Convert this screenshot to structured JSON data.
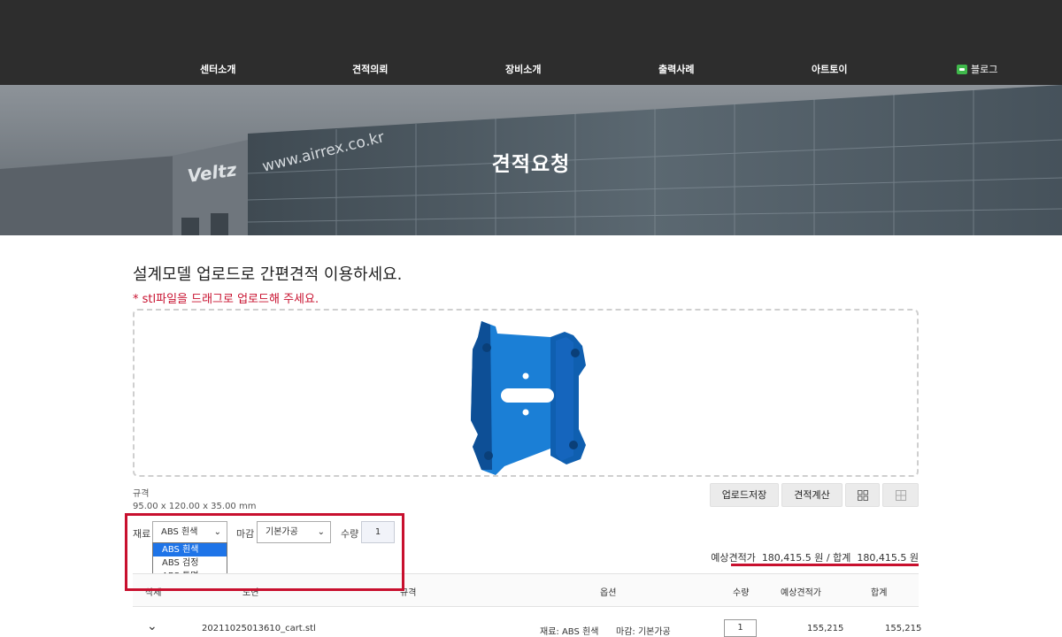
{
  "nav": {
    "items": [
      "센터소개",
      "견적의뢰",
      "장비소개",
      "출력사례",
      "아트토이"
    ],
    "blog": "블로그"
  },
  "hero": {
    "title": "견적요청"
  },
  "upload": {
    "headline": "설계모델 업로드로 간편견적 이용하세요.",
    "note": "* stl파일을 드래그로 업로드해 주세요."
  },
  "spec": {
    "label": "규격",
    "value": "95.00 x 120.00 x 35.00 mm"
  },
  "buttons": {
    "save": "업로드저장",
    "calc": "견적계산"
  },
  "options": {
    "material_label": "재료",
    "material_selected": "ABS 흰색",
    "material_options": [
      "ABS 흰색",
      "ABS 검정",
      "ABS 투명"
    ],
    "finish_label": "마감",
    "finish_selected": "기본가공",
    "qty_label": "수량",
    "qty_value": "1"
  },
  "estimate": {
    "label": "예상견적가",
    "amount": "180,415.5 원",
    "sep": "/",
    "total_label": "합계",
    "total": "180,415.5 원"
  },
  "table": {
    "headers": [
      "삭제",
      "도면",
      "규격",
      "옵션",
      "수량",
      "예상견적가",
      "합계"
    ],
    "row": {
      "filename": "20211025013610_cart.stl",
      "material": "재료: ABS 흰색",
      "finish": "마감: 기본가공",
      "qty": "1",
      "price": "155,215",
      "total": "155,215"
    }
  },
  "colors": {
    "accent": "#c8102e",
    "topbar": "#2d2d2d",
    "model": "#1a7fd4"
  }
}
